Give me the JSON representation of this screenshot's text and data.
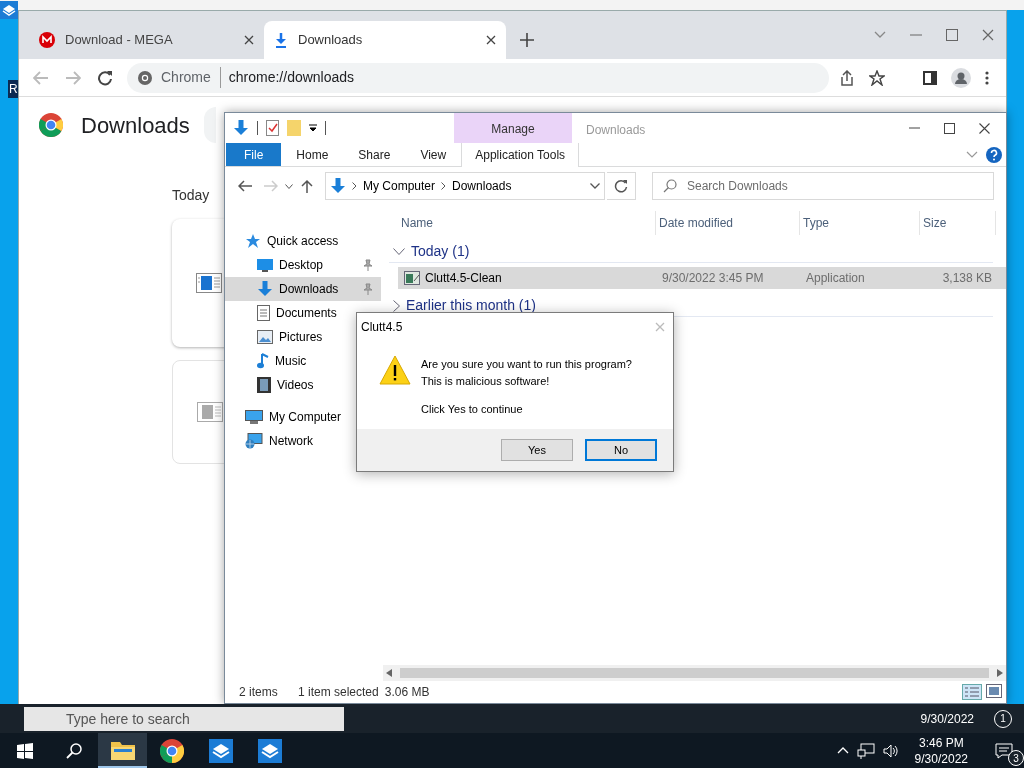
{
  "desktop": {
    "icon_label": "R"
  },
  "chrome": {
    "tabs": [
      {
        "label": "Download - MEGA",
        "kind": "mega",
        "selected": false
      },
      {
        "label": "Downloads",
        "kind": "download",
        "selected": true
      }
    ],
    "omnibox": {
      "site": "Chrome",
      "url": "chrome://downloads"
    },
    "page_title": "Downloads",
    "section": "Today"
  },
  "explorer": {
    "title": "Downloads",
    "context_group": "Manage",
    "ribbon_tabs": [
      {
        "label": "File",
        "kind": "file"
      },
      {
        "label": "Home",
        "kind": "plain"
      },
      {
        "label": "Share",
        "kind": "plain"
      },
      {
        "label": "View",
        "kind": "plain"
      },
      {
        "label": "Application Tools",
        "kind": "context"
      }
    ],
    "breadcrumbs": [
      "My Computer",
      "Downloads"
    ],
    "search": {
      "placeholder": "Search Downloads"
    },
    "columns": [
      "Name",
      "Date modified",
      "Type",
      "Size"
    ],
    "nav": [
      {
        "label": "Quick access",
        "kind": "star",
        "selected": false,
        "pinned": false,
        "children": [
          {
            "label": "Desktop",
            "kind": "desktop",
            "selected": false,
            "pinned": true
          },
          {
            "label": "Downloads",
            "kind": "download",
            "selected": true,
            "pinned": true
          },
          {
            "label": "Documents",
            "kind": "document",
            "selected": false,
            "pinned": false
          },
          {
            "label": "Pictures",
            "kind": "image",
            "selected": false,
            "pinned": false
          },
          {
            "label": "Music",
            "kind": "music",
            "selected": false,
            "pinned": false
          },
          {
            "label": "Videos",
            "kind": "film",
            "selected": false,
            "pinned": false
          }
        ]
      },
      {
        "label": "My Computer",
        "kind": "computer",
        "selected": false,
        "pinned": false
      },
      {
        "label": "Network",
        "kind": "network",
        "selected": false,
        "pinned": false
      }
    ],
    "groups": [
      {
        "label": "Today (1)",
        "expanded": true,
        "items": [
          {
            "name": "Clutt4.5-Clean",
            "date": "9/30/2022 3:45 PM",
            "type": "Application",
            "size": "3,138 KB",
            "selected": true
          }
        ]
      },
      {
        "label": "Earlier this month (1)",
        "expanded": false
      }
    ],
    "status": {
      "count": "2 items",
      "selection": "1 item selected",
      "size": "3.06 MB"
    }
  },
  "dialog": {
    "title": "Clutt4.5",
    "lines": [
      "Are you sure you want to run this program?",
      "This is malicious software!"
    ],
    "note": "Click Yes to continue",
    "buttons": [
      {
        "label": "Yes",
        "default": false
      },
      {
        "label": "No",
        "default": true
      }
    ]
  },
  "ghost_taskbar": {
    "search_placeholder": "Type here to search",
    "date": "9/30/2022",
    "notifications": "1"
  },
  "taskbar": {
    "apps": [
      {
        "kind": "folder",
        "active": true
      },
      {
        "kind": "browser",
        "active": false
      },
      {
        "kind": "sandbox",
        "active": false
      },
      {
        "kind": "sandbox",
        "active": false
      }
    ],
    "time": "3:46 PM",
    "date": "9/30/2022",
    "notifications": "3"
  }
}
